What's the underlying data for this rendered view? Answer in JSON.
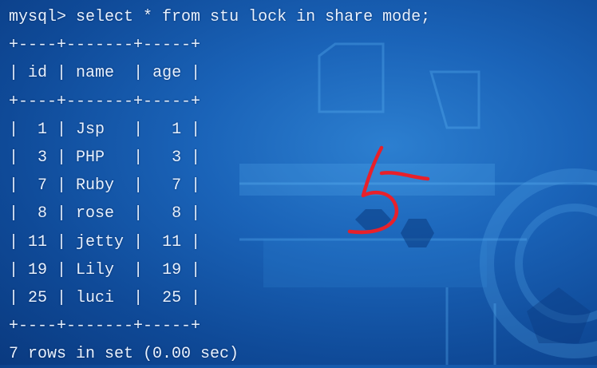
{
  "terminal": {
    "prompt": "mysql>",
    "command": "select * from stu lock in share mode;",
    "border": "+----+-------+-----+",
    "columns": [
      "id",
      "name",
      "age"
    ],
    "rows": [
      {
        "id": "1",
        "name": "Jsp",
        "age": "1"
      },
      {
        "id": "3",
        "name": "PHP",
        "age": "3"
      },
      {
        "id": "7",
        "name": "Ruby",
        "age": "7"
      },
      {
        "id": "8",
        "name": "rose",
        "age": "8"
      },
      {
        "id": "11",
        "name": "jetty",
        "age": "11"
      },
      {
        "id": "19",
        "name": "Lily",
        "age": "19"
      },
      {
        "id": "25",
        "name": "luci",
        "age": "25"
      }
    ],
    "footer": "7 rows in set (0.00 sec)"
  },
  "annotation": {
    "text": "5",
    "color": "#e8202a"
  },
  "colors": {
    "text": "#e8f2ff",
    "background": "#1a63b8"
  }
}
